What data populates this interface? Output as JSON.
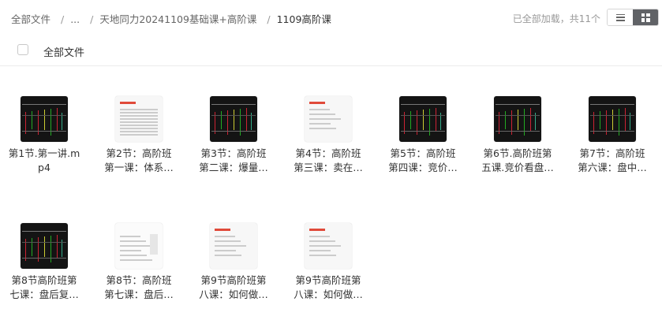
{
  "breadcrumb": {
    "items": [
      "全部文件",
      "...",
      "天地同力20241109基础课+高阶课"
    ],
    "current": "1109高阶课",
    "separator": "/"
  },
  "status": "已全部加载，共11个",
  "view": {
    "list_icon": "list-icon",
    "grid_icon": "grid-icon",
    "active": "grid"
  },
  "select_all_label": "全部文件",
  "files": [
    {
      "name": "第1节.第一讲.mp4",
      "line1": "第1节.第一讲.m",
      "line2": "p4",
      "thumb": "dark-chart"
    },
    {
      "name": "第2节：高阶班第一课：体系…",
      "line1": "第2节：高阶班",
      "line2": "第一课：体系…",
      "thumb": "light-table"
    },
    {
      "name": "第3节：高阶班第二课：爆量…",
      "line1": "第3节：高阶班",
      "line2": "第二课：爆量…",
      "thumb": "dark-chart"
    },
    {
      "name": "第4节：高阶班第三课：卖在…",
      "line1": "第4节：高阶班",
      "line2": "第三课：卖在…",
      "thumb": "light-slide"
    },
    {
      "name": "第5节：高阶班第四课：竞价…",
      "line1": "第5节：高阶班",
      "line2": "第四课：竞价…",
      "thumb": "dark-chart"
    },
    {
      "name": "第6节.高阶班第五课.竞价看盘…",
      "line1": "第6节.高阶班第",
      "line2": "五课.竞价看盘…",
      "thumb": "dark-chart"
    },
    {
      "name": "第7节：高阶班第六课：盘中…",
      "line1": "第7节：高阶班",
      "line2": "第六课：盘中…",
      "thumb": "dark-chart"
    },
    {
      "name": "第8节高阶班第七课：盘后复…",
      "line1": "第8节高阶班第",
      "line2": "七课：盘后复…",
      "thumb": "dark-chart"
    },
    {
      "name": "第8节：高阶班第七课：盘后…",
      "line1": "第8节：高阶班",
      "line2": "第七课：盘后…",
      "thumb": "light-web"
    },
    {
      "name": "第9节高阶班第八课：如何做…",
      "line1": "第9节高阶班第",
      "line2": "八课：如何做…",
      "thumb": "light-slide"
    },
    {
      "name": "第9节高阶班第八课：如何做…",
      "line1": "第9节高阶班第",
      "line2": "八课：如何做…",
      "thumb": "light-slide"
    }
  ]
}
